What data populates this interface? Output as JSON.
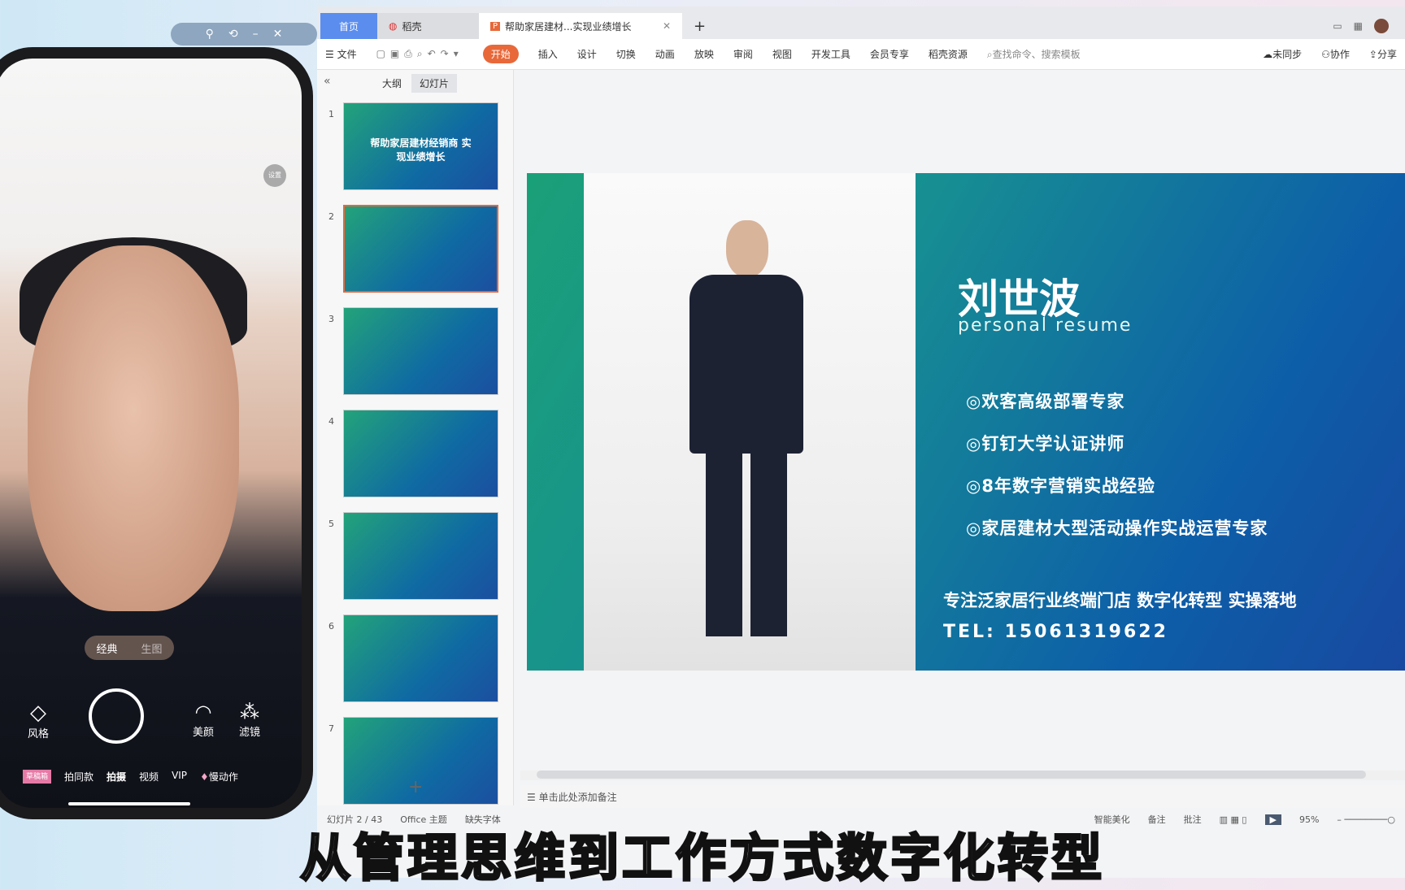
{
  "phone": {
    "window_controls": [
      "pin",
      "restore",
      "minimize",
      "close"
    ],
    "settings": "设置",
    "modes": [
      "经典",
      "生图"
    ],
    "tools": [
      {
        "icon": "diamond-icon",
        "label": "风格"
      },
      {
        "icon": "face-icon",
        "label": "美颜"
      },
      {
        "icon": "filter-icon",
        "label": "滤镜"
      }
    ],
    "bottom_tabs": [
      "草稿箱",
      "拍同款",
      "拍摄",
      "视频",
      "VIP",
      "慢动作"
    ]
  },
  "tabs": [
    {
      "label": "首页"
    },
    {
      "label": "稻壳"
    },
    {
      "label": "帮助家居建材...实现业绩增长"
    }
  ],
  "menu": {
    "file": "文件",
    "items": [
      "开始",
      "插入",
      "设计",
      "切换",
      "动画",
      "放映",
      "审阅",
      "视图",
      "开发工具",
      "会员专享",
      "稻壳资源"
    ],
    "search_placeholder": "查找命令、搜索模板",
    "sync": "未同步",
    "collab": "协作",
    "share": "分享"
  },
  "panel": {
    "tabs": [
      "大纲",
      "幻灯片"
    ],
    "thumbs": [
      "1",
      "2",
      "3",
      "4",
      "5",
      "6",
      "7"
    ],
    "thumb1_title": "帮助家居建材经销商 实现业绩增长"
  },
  "slide": {
    "name": "刘世波",
    "subtitle": "personal resume",
    "bullets": [
      "欢客高级部署专家",
      "钉钉大学认证讲师",
      "8年数字营销实战经验",
      "家居建材大型活动操作实战运营专家"
    ],
    "tagline": "专注泛家居行业终端门店 数字化转型  实操落地",
    "tel": "TEL:  15061319622"
  },
  "notes": "单击此处添加备注",
  "status": {
    "slide": "幻灯片 2 / 43",
    "theme": "Office 主题",
    "font": "缺失字体",
    "beautify": "智能美化",
    "notes": "备注",
    "comment": "批注",
    "zoom": "95%"
  },
  "subtitle": "从管理思维到工作方式数字化转型",
  "colors": {
    "accent": "#e8683a",
    "tab_active": "#5b8def"
  }
}
